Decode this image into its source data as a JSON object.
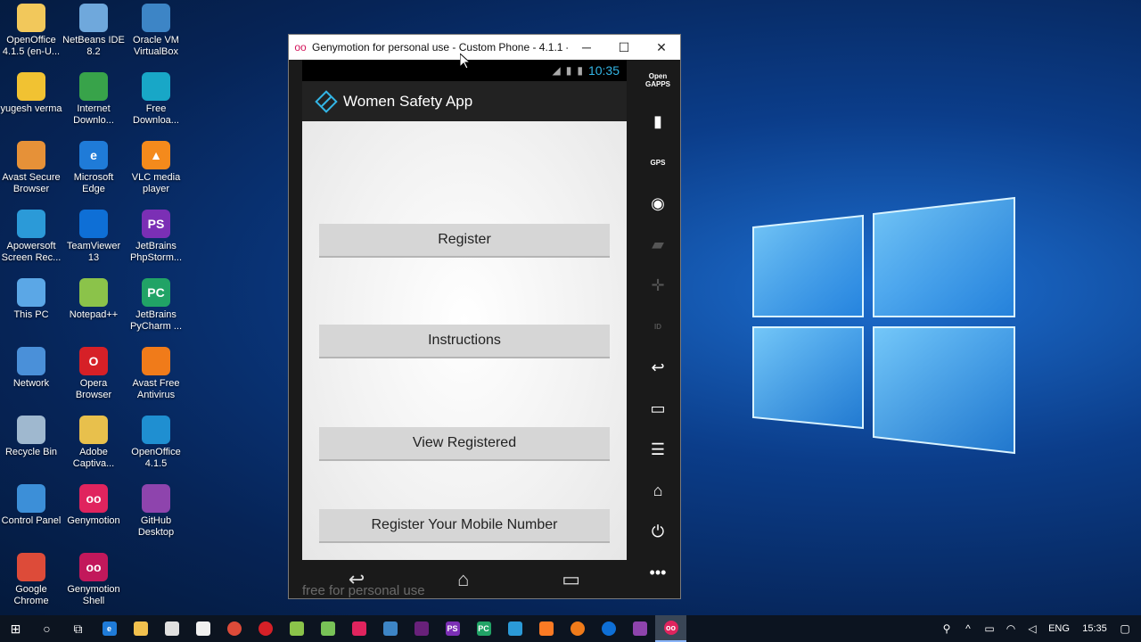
{
  "desktop": {
    "icons": [
      {
        "label": "OpenOffice 4.1.5 (en-U...",
        "icon": "openoffice-folder-icon",
        "glyph": "",
        "color": "#f2c85b"
      },
      {
        "label": "NetBeans IDE 8.2",
        "icon": "netbeans-icon",
        "glyph": "",
        "color": "#6fa8dc"
      },
      {
        "label": "Oracle VM VirtualBox",
        "icon": "virtualbox-icon",
        "glyph": "",
        "color": "#3d85c6"
      },
      {
        "label": "yugesh verma",
        "icon": "user-folder-icon",
        "glyph": "",
        "color": "#f1c232"
      },
      {
        "label": "Internet Downlo...",
        "icon": "internet-download-manager-icon",
        "glyph": "",
        "color": "#38a34a"
      },
      {
        "label": "Free Downloa...",
        "icon": "free-download-manager-icon",
        "glyph": "",
        "color": "#18a7c7"
      },
      {
        "label": "Avast Secure Browser",
        "icon": "avast-secure-browser-icon",
        "glyph": "",
        "color": "#e69138"
      },
      {
        "label": "Microsoft Edge",
        "icon": "edge-icon",
        "glyph": "e",
        "color": "#1f7bd8"
      },
      {
        "label": "VLC media player",
        "icon": "vlc-icon",
        "glyph": "▲",
        "color": "#f48a1c"
      },
      {
        "label": "Apowersoft Screen Rec...",
        "icon": "apowersoft-icon",
        "glyph": "",
        "color": "#2b9ad8"
      },
      {
        "label": "TeamViewer 13",
        "icon": "teamviewer-icon",
        "glyph": "",
        "color": "#0e6fd6"
      },
      {
        "label": "JetBrains PhpStorm...",
        "icon": "phpstorm-icon",
        "glyph": "PS",
        "color": "#7b2fb5"
      },
      {
        "label": "This PC",
        "icon": "this-pc-icon",
        "glyph": "",
        "color": "#5ba7e6"
      },
      {
        "label": "Notepad++",
        "icon": "notepadpp-icon",
        "glyph": "",
        "color": "#8bc34a"
      },
      {
        "label": "JetBrains PyCharm ...",
        "icon": "pycharm-icon",
        "glyph": "PC",
        "color": "#21a366"
      },
      {
        "label": "Network",
        "icon": "network-icon",
        "glyph": "",
        "color": "#4a90d9"
      },
      {
        "label": "Opera Browser",
        "icon": "opera-icon",
        "glyph": "O",
        "color": "#d62027"
      },
      {
        "label": "Avast Free Antivirus",
        "icon": "avast-antivirus-icon",
        "glyph": "",
        "color": "#f07b1a"
      },
      {
        "label": "Recycle Bin",
        "icon": "recycle-bin-icon",
        "glyph": "",
        "color": "#9fb8cf"
      },
      {
        "label": "Adobe Captiva...",
        "icon": "adobe-captivate-icon",
        "glyph": "",
        "color": "#e8c04c"
      },
      {
        "label": "OpenOffice 4.1.5",
        "icon": "openoffice-icon",
        "glyph": "",
        "color": "#1f8fd1"
      },
      {
        "label": "Control Panel",
        "icon": "control-panel-icon",
        "glyph": "",
        "color": "#3c8fd8"
      },
      {
        "label": "Genymotion",
        "icon": "genymotion-icon",
        "glyph": "oo",
        "color": "#e0245e"
      },
      {
        "label": "GitHub Desktop",
        "icon": "github-desktop-icon",
        "glyph": "",
        "color": "#8e44ad"
      },
      {
        "label": "Google Chrome",
        "icon": "chrome-icon",
        "glyph": "",
        "color": "#dd4b39"
      },
      {
        "label": "Genymotion Shell",
        "icon": "genymotion-shell-icon",
        "glyph": "oo",
        "color": "#c2185b"
      }
    ]
  },
  "window": {
    "title": "Genymotion for personal use - Custom Phone - 4.1.1 - ...",
    "minimize": "─",
    "maximize": "☐",
    "close": "✕"
  },
  "phone": {
    "status_time": "10:35",
    "app_title": "Women Safety App",
    "buttons": [
      "Register",
      "Instructions",
      "View Registered",
      "Register Your Mobile Number"
    ],
    "watermark": "free for personal use"
  },
  "sidebar": {
    "open_gapps": "Open GAPPS",
    "gps": "GPS",
    "id": "ID"
  },
  "taskbar": {
    "language": "ENG",
    "time": "15:35"
  },
  "colors": {
    "accent": "#33b5e5",
    "genymotion": "#d4145a"
  }
}
